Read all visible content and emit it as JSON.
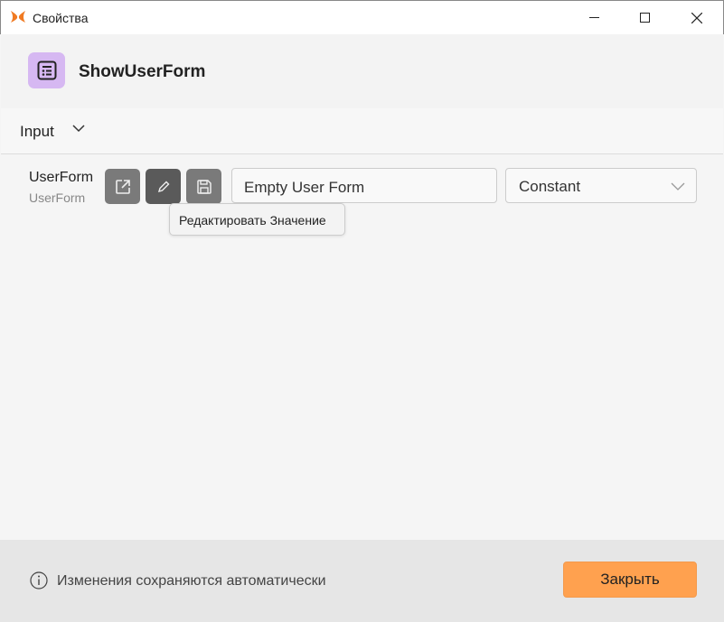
{
  "window": {
    "title": "Свойства",
    "minimize_icon": "minimize-icon",
    "maximize_icon": "maximize-icon",
    "close_icon": "close-icon"
  },
  "header": {
    "icon": "form-list-icon",
    "name": "ShowUserForm",
    "icon_color": "#d6b8f2"
  },
  "section": {
    "label": "Input"
  },
  "property": {
    "label": "UserForm",
    "type": "UserForm",
    "value": "Empty User Form",
    "mode": "Constant",
    "buttons": [
      "open-external-icon",
      "pencil-icon",
      "save-icon"
    ]
  },
  "tooltip": {
    "text": "Редактировать Значение"
  },
  "footer": {
    "note": "Изменения сохраняются автоматически",
    "close_label": "Закрыть",
    "accent": "#ffa14f"
  }
}
